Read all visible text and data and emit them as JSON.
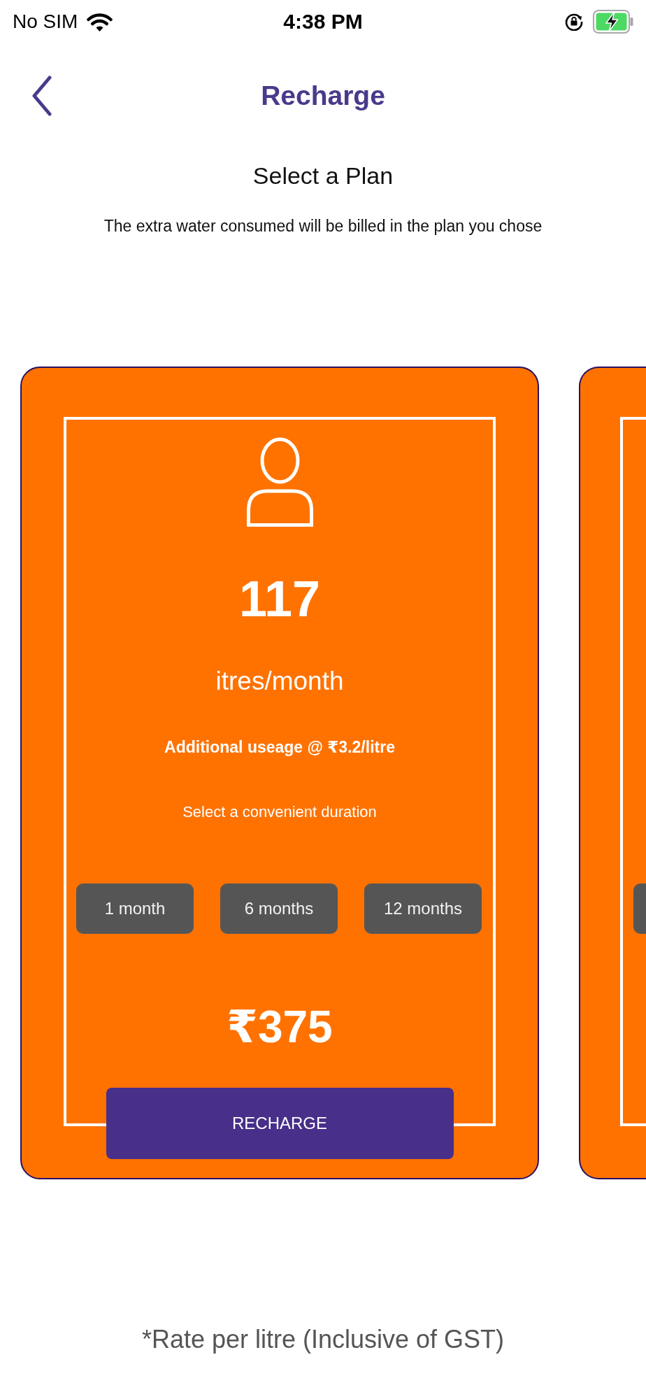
{
  "status_bar": {
    "carrier": "No SIM",
    "time": "4:38 PM"
  },
  "header": {
    "title": "Recharge"
  },
  "intro": {
    "title": "Select a Plan",
    "subtitle": "The extra water consumed will be billed in the plan you chose"
  },
  "plans": [
    {
      "kind": "full",
      "quantity": "117",
      "unit": "itres/month",
      "additional_usage": "Additional useage @ ₹3.2/litre",
      "duration_prompt": "Select a convenient duration",
      "durations": [
        {
          "label": "1 month",
          "selected": false
        },
        {
          "label": "6 months",
          "selected": false
        },
        {
          "label": "12 months",
          "selected": false
        }
      ],
      "price": "₹375",
      "action": "RECHARGE"
    },
    {
      "kind": "peek"
    }
  ],
  "footnote": "*Rate per litre (Inclusive of GST)"
}
